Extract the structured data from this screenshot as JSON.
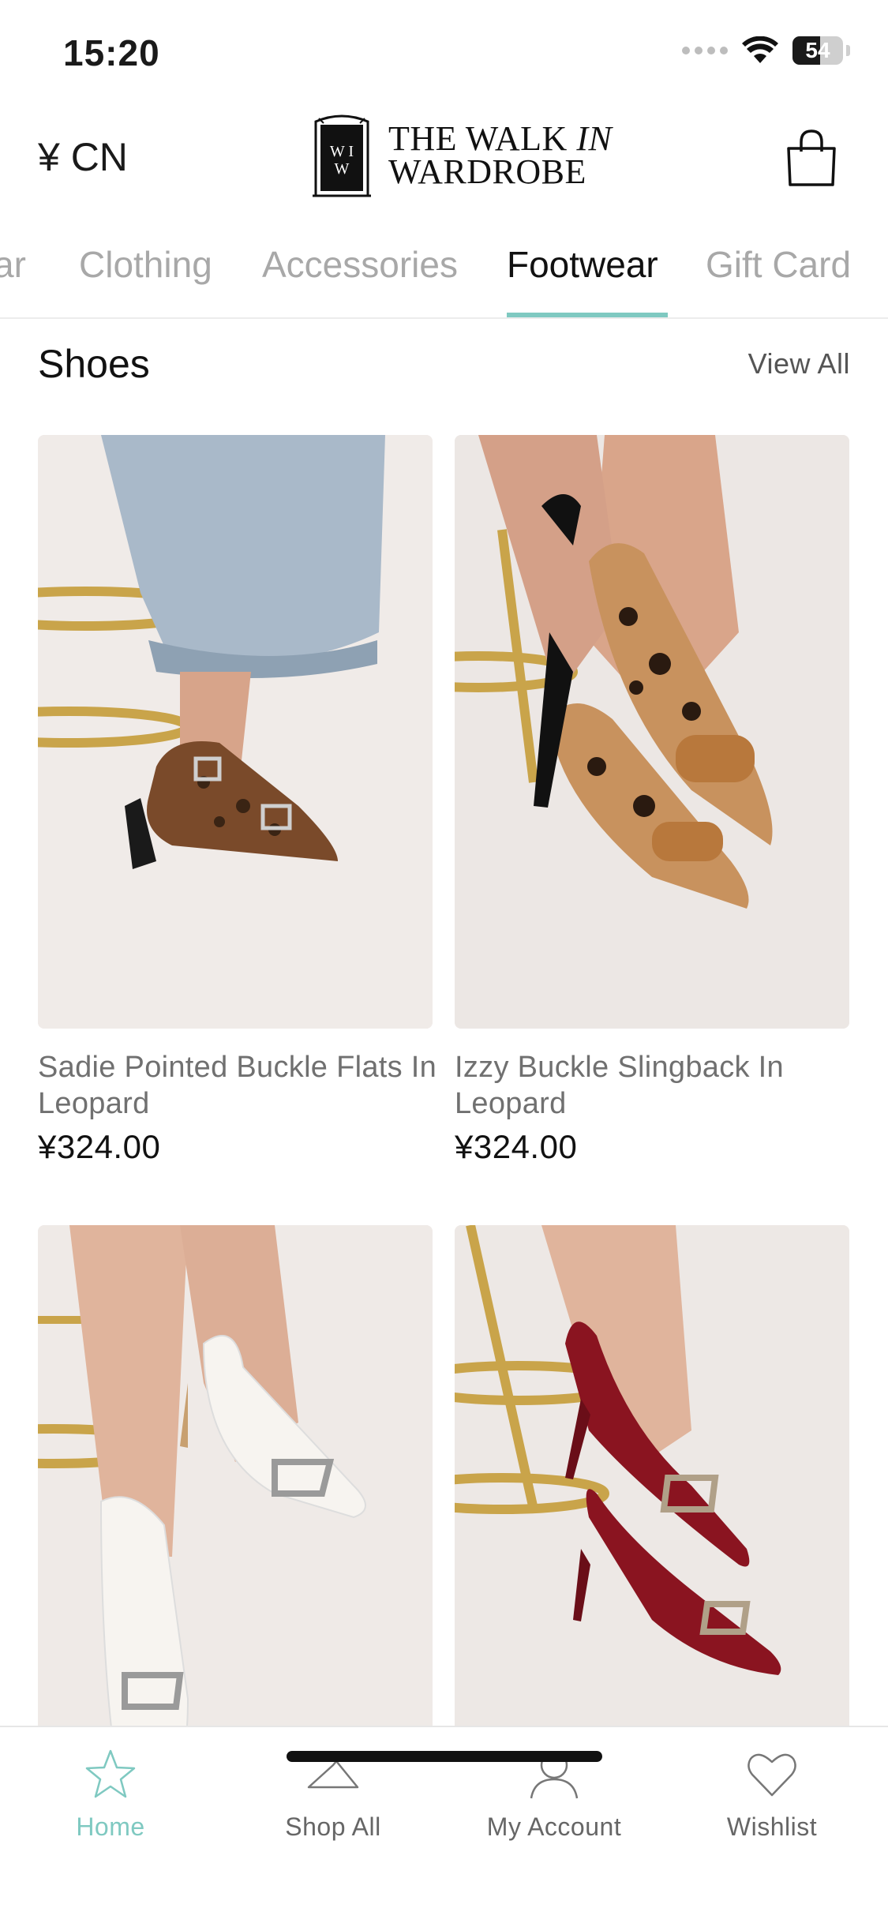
{
  "status_bar": {
    "time": "15:20",
    "battery_level": "54",
    "battery_fraction": 0.54,
    "icons": [
      "signal-dots-icon",
      "wifi-icon",
      "battery-icon"
    ]
  },
  "header": {
    "currency": "¥ CN",
    "logo_monogram": "WIW",
    "logo_line1_a": "THE WALK ",
    "logo_line1_b": "IN",
    "logo_line2": "WARDROBE",
    "bag_icon": "shopping-bag-icon"
  },
  "tabs": {
    "items": [
      {
        "label": "ar"
      },
      {
        "label": "Clothing"
      },
      {
        "label": "Accessories"
      },
      {
        "label": "Footwear"
      },
      {
        "label": "Gift Card"
      }
    ],
    "active": "Footwear",
    "accent": "#7fc9c1"
  },
  "section": {
    "title": "Shoes",
    "view_all": "View All"
  },
  "products": [
    {
      "name": "Sadie Pointed Buckle Flats In Leopard",
      "price": "¥324.00"
    },
    {
      "name": "Izzy Buckle Slingback In Leopard",
      "price": "¥324.00"
    },
    {
      "name": "",
      "price": ""
    },
    {
      "name": "",
      "price": ""
    }
  ],
  "bottom_nav": {
    "items": [
      {
        "label": "Home",
        "icon": "star-icon",
        "active": true
      },
      {
        "label": "Shop All",
        "icon": "hanger-icon",
        "active": false
      },
      {
        "label": "My Account",
        "icon": "user-icon",
        "active": false
      },
      {
        "label": "Wishlist",
        "icon": "heart-icon",
        "active": false
      }
    ],
    "active_color": "#7fc9c1"
  }
}
